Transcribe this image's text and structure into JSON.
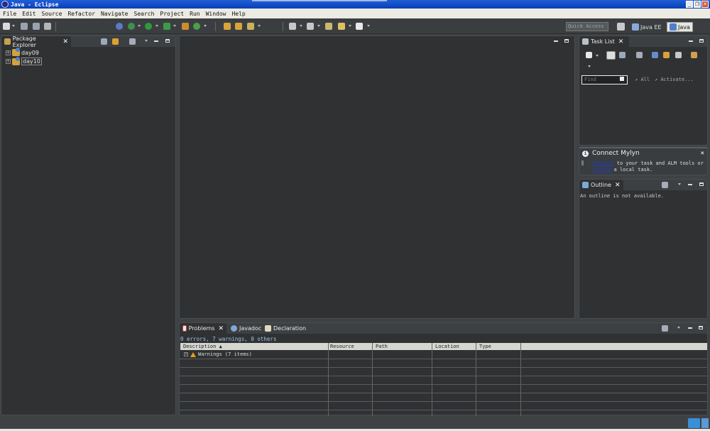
{
  "window": {
    "title": "Java - Eclipse"
  },
  "menu": [
    "File",
    "Edit",
    "Source",
    "Refactor",
    "Navigate",
    "Search",
    "Project",
    "Run",
    "Window",
    "Help"
  ],
  "quick_access": {
    "placeholder": "Quick Access"
  },
  "perspectives": [
    {
      "label": "Java EE"
    },
    {
      "label": "Java"
    }
  ],
  "package_explorer": {
    "tab": "Package Explorer",
    "projects": [
      "day09",
      "day10"
    ]
  },
  "task_list": {
    "tab": "Task List",
    "find_placeholder": "Find",
    "filter_all": "All",
    "filter_activate": "Activate..."
  },
  "mylyn": {
    "title": "Connect Mylyn",
    "link1": "Connect",
    "text1": " to your task and ALM tools or",
    "link2": "create",
    "text2": " a local task."
  },
  "outline": {
    "tab": "Outline",
    "message": "An outline is not available."
  },
  "problems": {
    "tabs": [
      "Problems",
      "Javadoc",
      "Declaration"
    ],
    "summary": "0 errors, 7 warnings, 0 others",
    "columns": [
      "Description",
      "Resource",
      "Path",
      "Location",
      "Type"
    ],
    "rows": [
      {
        "label": "Warnings (7 items)"
      }
    ]
  },
  "colors": {
    "editor_bg": "#2f3133",
    "link": "#1e3cc8",
    "warning": "#e0a020"
  }
}
